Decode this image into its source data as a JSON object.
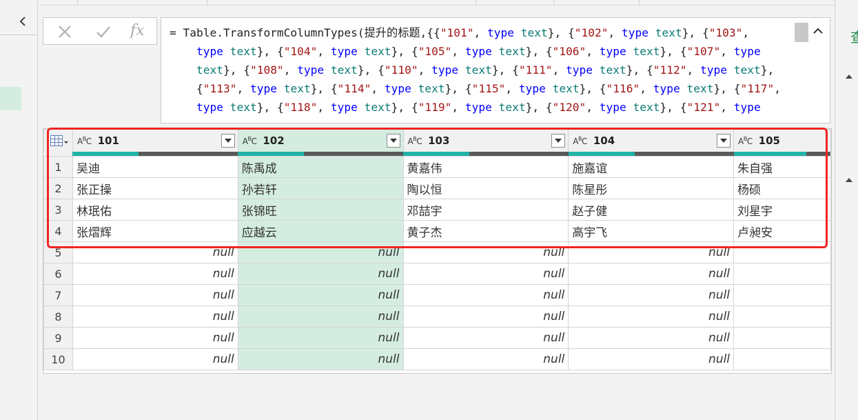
{
  "formula_bar": {
    "cancel_icon": "close-icon",
    "confirm_icon": "check-icon",
    "fx_label": "fx",
    "lines": [
      [
        [
          "p",
          "= Table.TransformColumnTypes(提升的标题,{{"
        ],
        [
          "s",
          "\"101\""
        ],
        [
          "p",
          ", "
        ],
        [
          "k",
          "type"
        ],
        [
          "p",
          " "
        ],
        [
          "t",
          "text"
        ],
        [
          "p",
          "}, {"
        ],
        [
          "s",
          "\"102\""
        ],
        [
          "p",
          ", "
        ],
        [
          "k",
          "type"
        ],
        [
          "p",
          " "
        ],
        [
          "t",
          "text"
        ],
        [
          "p",
          "}, {"
        ],
        [
          "s",
          "\"103\""
        ],
        [
          "p",
          ","
        ]
      ],
      [
        [
          "p",
          "    "
        ],
        [
          "k",
          "type"
        ],
        [
          "p",
          " "
        ],
        [
          "t",
          "text"
        ],
        [
          "p",
          "}, {"
        ],
        [
          "s",
          "\"104\""
        ],
        [
          "p",
          ", "
        ],
        [
          "k",
          "type"
        ],
        [
          "p",
          " "
        ],
        [
          "t",
          "text"
        ],
        [
          "p",
          "}, {"
        ],
        [
          "s",
          "\"105\""
        ],
        [
          "p",
          ", "
        ],
        [
          "k",
          "type"
        ],
        [
          "p",
          " "
        ],
        [
          "t",
          "text"
        ],
        [
          "p",
          "}, {"
        ],
        [
          "s",
          "\"106\""
        ],
        [
          "p",
          ", "
        ],
        [
          "k",
          "type"
        ],
        [
          "p",
          " "
        ],
        [
          "t",
          "text"
        ],
        [
          "p",
          "}, {"
        ],
        [
          "s",
          "\"107\""
        ],
        [
          "p",
          ", "
        ],
        [
          "k",
          "type"
        ]
      ],
      [
        [
          "p",
          "    "
        ],
        [
          "t",
          "text"
        ],
        [
          "p",
          "}, {"
        ],
        [
          "s",
          "\"108\""
        ],
        [
          "p",
          ", "
        ],
        [
          "k",
          "type"
        ],
        [
          "p",
          " "
        ],
        [
          "t",
          "text"
        ],
        [
          "p",
          "}, {"
        ],
        [
          "s",
          "\"110\""
        ],
        [
          "p",
          ", "
        ],
        [
          "k",
          "type"
        ],
        [
          "p",
          " "
        ],
        [
          "t",
          "text"
        ],
        [
          "p",
          "}, {"
        ],
        [
          "s",
          "\"111\""
        ],
        [
          "p",
          ", "
        ],
        [
          "k",
          "type"
        ],
        [
          "p",
          " "
        ],
        [
          "t",
          "text"
        ],
        [
          "p",
          "}, {"
        ],
        [
          "s",
          "\"112\""
        ],
        [
          "p",
          ", "
        ],
        [
          "k",
          "type"
        ],
        [
          "p",
          " "
        ],
        [
          "t",
          "text"
        ],
        [
          "p",
          "},"
        ]
      ],
      [
        [
          "p",
          "    {"
        ],
        [
          "s",
          "\"113\""
        ],
        [
          "p",
          ", "
        ],
        [
          "k",
          "type"
        ],
        [
          "p",
          " "
        ],
        [
          "t",
          "text"
        ],
        [
          "p",
          "}, {"
        ],
        [
          "s",
          "\"114\""
        ],
        [
          "p",
          ", "
        ],
        [
          "k",
          "type"
        ],
        [
          "p",
          " "
        ],
        [
          "t",
          "text"
        ],
        [
          "p",
          "}, {"
        ],
        [
          "s",
          "\"115\""
        ],
        [
          "p",
          ", "
        ],
        [
          "k",
          "type"
        ],
        [
          "p",
          " "
        ],
        [
          "t",
          "text"
        ],
        [
          "p",
          "}, {"
        ],
        [
          "s",
          "\"116\""
        ],
        [
          "p",
          ", "
        ],
        [
          "k",
          "type"
        ],
        [
          "p",
          " "
        ],
        [
          "t",
          "text"
        ],
        [
          "p",
          "}, {"
        ],
        [
          "s",
          "\"117\""
        ],
        [
          "p",
          ","
        ]
      ],
      [
        [
          "p",
          "    "
        ],
        [
          "k",
          "type"
        ],
        [
          "p",
          " "
        ],
        [
          "t",
          "text"
        ],
        [
          "p",
          "}, {"
        ],
        [
          "s",
          "\"118\""
        ],
        [
          "p",
          ", "
        ],
        [
          "k",
          "type"
        ],
        [
          "p",
          " "
        ],
        [
          "t",
          "text"
        ],
        [
          "p",
          "}, {"
        ],
        [
          "s",
          "\"119\""
        ],
        [
          "p",
          ", "
        ],
        [
          "k",
          "type"
        ],
        [
          "p",
          " "
        ],
        [
          "t",
          "text"
        ],
        [
          "p",
          "}, {"
        ],
        [
          "s",
          "\"120\""
        ],
        [
          "p",
          ", "
        ],
        [
          "k",
          "type"
        ],
        [
          "p",
          " "
        ],
        [
          "t",
          "text"
        ],
        [
          "p",
          "}, {"
        ],
        [
          "s",
          "\"121\""
        ],
        [
          "p",
          ", "
        ],
        [
          "k",
          "type"
        ]
      ]
    ]
  },
  "grid": {
    "type_badge": "ABC",
    "columns": [
      {
        "name": "101",
        "quality_valid": 0.4
      },
      {
        "name": "102",
        "quality_valid": 0.4
      },
      {
        "name": "103",
        "quality_valid": 0.4
      },
      {
        "name": "104",
        "quality_valid": 0.4
      },
      {
        "name": "105",
        "quality_valid": 0.75
      }
    ],
    "highlighted_column": 1,
    "rows": [
      {
        "n": "1",
        "cells": [
          "吴迪",
          "陈禹成",
          "黄嘉伟",
          "施嘉谊",
          "朱自强"
        ]
      },
      {
        "n": "2",
        "cells": [
          "张正操",
          "孙若轩",
          "陶以恒",
          "陈星彤",
          "杨硕"
        ]
      },
      {
        "n": "3",
        "cells": [
          "林珉佑",
          "张锦旺",
          "邓喆宇",
          "赵子健",
          "刘星宇"
        ]
      },
      {
        "n": "4",
        "cells": [
          "张熠辉",
          "应越云",
          "黄子杰",
          "高宇飞",
          "卢昶安"
        ]
      },
      {
        "n": "5",
        "cells": [
          "null",
          "null",
          "null",
          "null",
          ""
        ]
      },
      {
        "n": "6",
        "cells": [
          "null",
          "null",
          "null",
          "null",
          ""
        ]
      },
      {
        "n": "7",
        "cells": [
          "null",
          "null",
          "null",
          "null",
          ""
        ]
      },
      {
        "n": "8",
        "cells": [
          "null",
          "null",
          "null",
          "null",
          ""
        ]
      },
      {
        "n": "9",
        "cells": [
          "null",
          "null",
          "null",
          "null",
          ""
        ]
      },
      {
        "n": "10",
        "cells": [
          "null",
          "null",
          "null",
          "null",
          ""
        ]
      }
    ]
  },
  "right_pane": {
    "label": "查"
  },
  "colors": {
    "accent_green": "#1e8c4c",
    "selection": "#d4ede0",
    "quality_valid": "#22b3a8",
    "annotation_red": "#f22424"
  }
}
